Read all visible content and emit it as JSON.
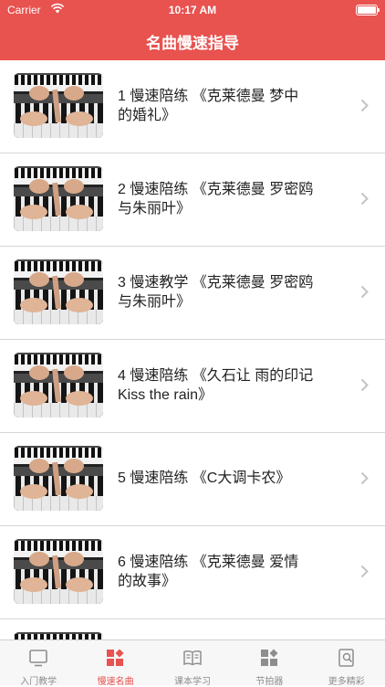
{
  "status_bar": {
    "carrier": "Carrier",
    "time": "10:17 AM"
  },
  "header": {
    "title": "名曲慢速指导"
  },
  "list": {
    "items": [
      {
        "line1": "1  慢速陪练 《克莱德曼 梦中",
        "line2": "的婚礼》"
      },
      {
        "line1": "2  慢速陪练 《克莱德曼 罗密鸥",
        "line2": "与朱丽叶》"
      },
      {
        "line1": "3  慢速教学 《克莱德曼 罗密鸥",
        "line2": "与朱丽叶》"
      },
      {
        "line1": "4  慢速陪练 《久石让 雨的印记",
        "line2": "Kiss the rain》"
      },
      {
        "line1": "5  慢速陪练 《C大调卡农》",
        "line2": ""
      },
      {
        "line1": "6  慢速陪练 《克莱德曼 爱情",
        "line2": "的故事》"
      },
      {
        "line1": "",
        "line2": ""
      }
    ]
  },
  "tabbar": {
    "tabs": [
      {
        "label": "入门教学",
        "icon": "monitor-icon",
        "active": false
      },
      {
        "label": "慢速名曲",
        "icon": "blocks-icon",
        "active": true
      },
      {
        "label": "课本学习",
        "icon": "book-icon",
        "active": false
      },
      {
        "label": "节拍器",
        "icon": "grid-icon",
        "active": false
      },
      {
        "label": "更多精彩",
        "icon": "search-doc-icon",
        "active": false
      }
    ]
  },
  "colors": {
    "accent": "#e8524f",
    "inactive": "#8e8e8e"
  }
}
